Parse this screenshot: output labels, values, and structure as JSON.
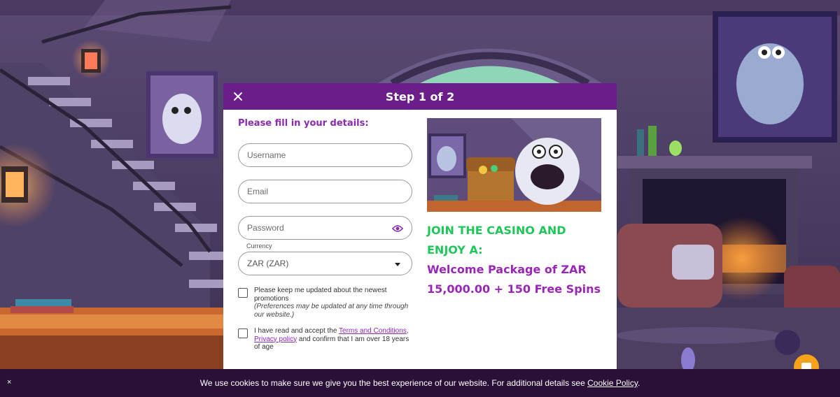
{
  "modal": {
    "title": "Step 1 of 2",
    "close_icon": "close-icon",
    "form_heading": "Please fill in your details:",
    "username_placeholder": "Username",
    "email_placeholder": "Email",
    "password_placeholder": "Password",
    "currency_label": "Currency",
    "currency_value": "ZAR (ZAR)",
    "promotions_text": "Please keep me updated about the newest promotions",
    "promotions_note": "(Preferences may be updated at any time through our website.)",
    "terms_prefix": "I have read and accept the ",
    "terms_link": "Terms and Conditions",
    "terms_sep": ",",
    "privacy_link": "Privacy policy",
    "terms_suffix": " and confirm that I am over 18 years of age",
    "promo_line1": "JOIN THE CASINO AND ENJOY A:",
    "promo_line2": "Welcome Package of ZAR 15,000.00 + 150 Free Spins"
  },
  "cookie_bar": {
    "close": "×",
    "text": "We use cookies to make sure we give you the best experience of our website. For additional details see ",
    "link": "Cookie Policy",
    "end": "."
  },
  "colors": {
    "header": "#6b1d8a",
    "accent_purple": "#8a2bb0",
    "promo_green": "#1fc65a",
    "cookie_bg": "#2a0f36",
    "chat_button": "#f7a21b"
  }
}
